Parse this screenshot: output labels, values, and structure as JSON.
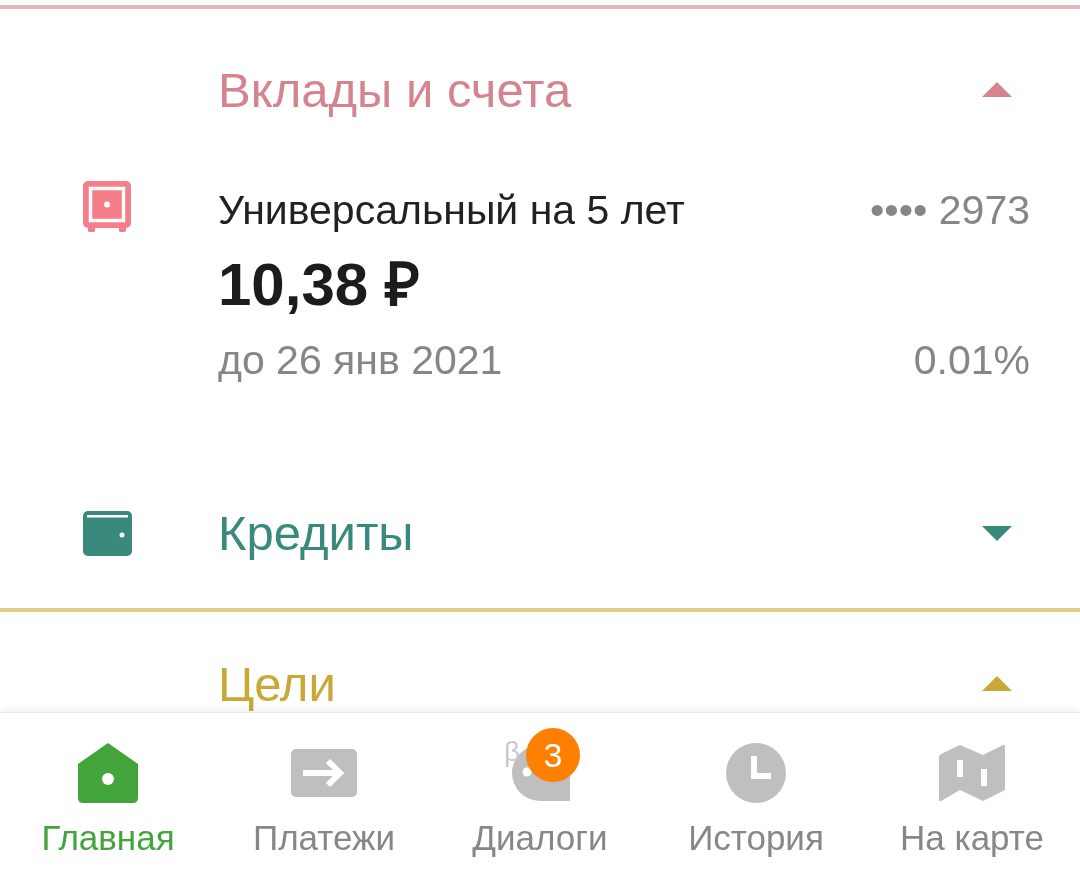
{
  "sections": [
    {
      "kind": "group",
      "title": "Вклады и счета",
      "color": "#d4848f",
      "expanded": true,
      "items": [
        {
          "kind": "deposit",
          "name": "Универсальный на 5 лет",
          "account_number": "•••• 2973",
          "amount": "10,38 ₽",
          "term": "до 26 янв 2021",
          "rate": "0.01%"
        }
      ]
    },
    {
      "kind": "icon_row",
      "title": "Кредиты",
      "color": "#398a7c",
      "expanded": false
    },
    {
      "kind": "group",
      "title": "Цели",
      "color": "#c9a935",
      "expanded": true
    }
  ],
  "bottom_nav": [
    {
      "kind": "home",
      "label": "Главная",
      "selected": true
    },
    {
      "kind": "transfer",
      "label": "Платежи",
      "selected": false
    },
    {
      "kind": "chat",
      "label": "Диалоги",
      "selected": false,
      "badge": "3",
      "beta_mark": "β"
    },
    {
      "kind": "clock",
      "label": "История",
      "selected": false
    },
    {
      "kind": "map",
      "label": "На карте",
      "selected": false
    }
  ]
}
